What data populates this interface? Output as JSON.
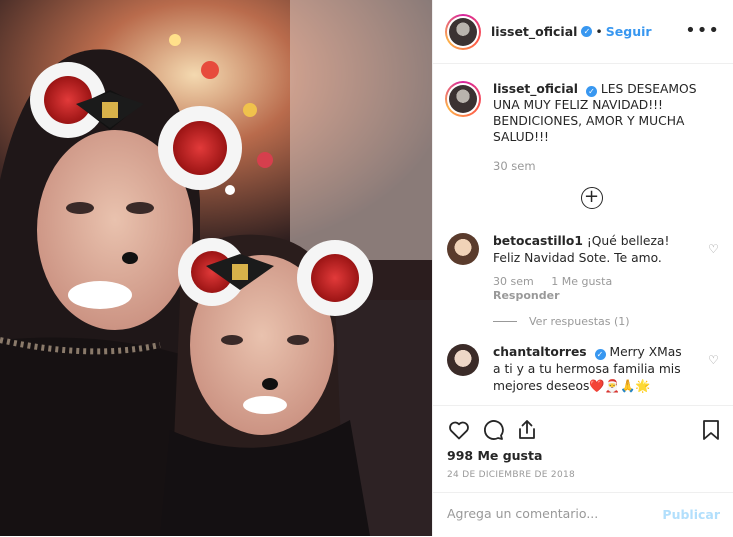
{
  "post": {
    "username": "lisset_oficial",
    "follow_label": "Seguir",
    "separator": "•",
    "more_label": "•••"
  },
  "caption": {
    "username": "lisset_oficial",
    "text": "LES DESEAMOS UNA MUY FELIZ NAVIDAD!!! BENDICIONES, AMOR Y MUCHA SALUD!!!",
    "time": "30 sem",
    "load_more": "+"
  },
  "comments": [
    {
      "username": "betocastillo1",
      "text": "¡Qué belleza! Feliz Navidad Sote. Te amo.",
      "time": "30 sem",
      "likes": "1 Me gusta",
      "reply": "Responder",
      "view_replies": "Ver respuestas (1)"
    },
    {
      "username": "chantaltorres",
      "text": "Merry XMas a ti y a tu hermosa familia mis mejores deseos❤️🎅🙏🌟"
    }
  ],
  "footer": {
    "likes": "998 Me gusta",
    "date": "24 DE DICIEMBRE DE 2018",
    "comment_placeholder": "Agrega un comentario...",
    "publish_label": "Publicar"
  },
  "colors": {
    "accent": "#3897f0",
    "text": "#262626",
    "muted": "#999999",
    "publish_disabled": "#b2dffc"
  },
  "icons": [
    "heart-icon",
    "comment-icon",
    "share-icon",
    "bookmark-icon",
    "verified-badge-icon",
    "plus-circle-icon"
  ]
}
